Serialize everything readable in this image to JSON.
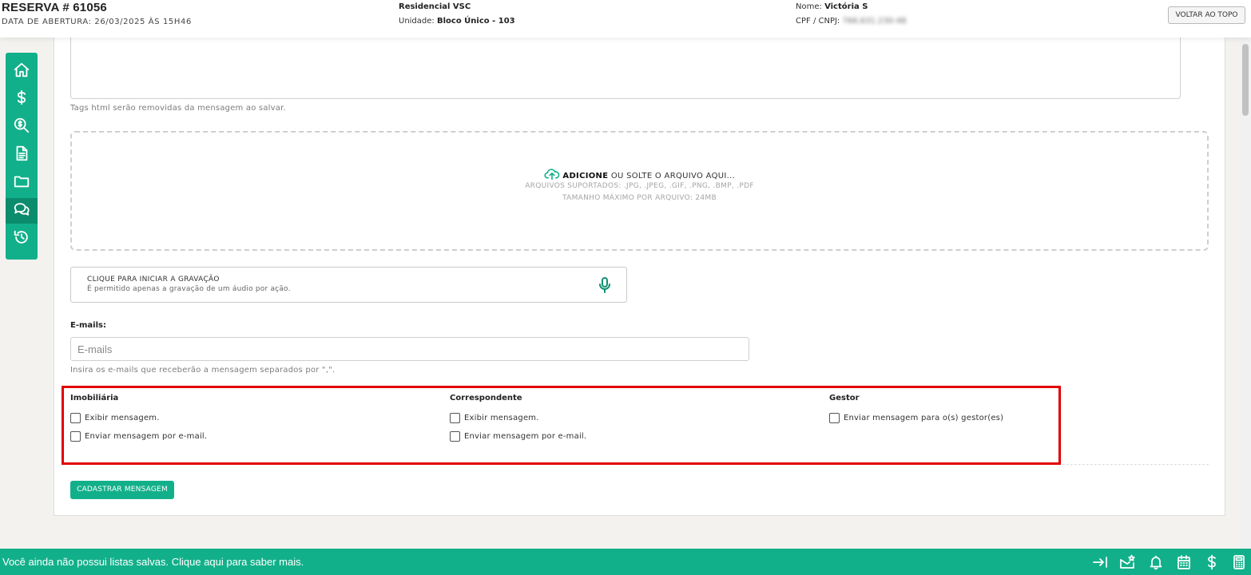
{
  "header": {
    "title": "RESERVA # 61056",
    "subtitle": "DATA DE ABERTURA: 26/03/2025 ÀS 15H46",
    "project_value": "Residencial VSC",
    "unit_label": "Unidade:",
    "unit_value": "Bloco Único - 103",
    "name_label": "Nome:",
    "name_value": "Victória S",
    "cpf_label": "CPF / CNPJ:",
    "cpf_value": "766.631.230-48",
    "back_to_top": "VOLTAR AO TOPO"
  },
  "sidebar": {
    "items": [
      {
        "icon": "home-icon"
      },
      {
        "icon": "dollar-icon"
      },
      {
        "icon": "search-dollar-icon"
      },
      {
        "icon": "document-icon"
      },
      {
        "icon": "folder-icon"
      },
      {
        "icon": "chat-icon",
        "active": true
      },
      {
        "icon": "history-icon"
      }
    ]
  },
  "message": {
    "hint": "Tags html serão removidas da mensagem ao salvar."
  },
  "upload": {
    "add_label": "ADICIONE",
    "drop_text": " OU SOLTE O ARQUIVO AQUI...",
    "formats": "ARQUIVOS SUPORTADOS: .JPG, .JPEG, .GIF, .PNG, .BMP, .PDF",
    "max_size": "TAMANHO MÁXIMO POR ARQUIVO: 24MB"
  },
  "recording": {
    "title": "CLIQUE PARA INICIAR A GRAVAÇÃO",
    "subtitle": "É permitido apenas a gravação de um áudio por ação."
  },
  "emails": {
    "label": "E-mails:",
    "placeholder": "E-mails",
    "hint": "Insira os e-mails que receberão a mensagem separados por \",\"."
  },
  "groups": {
    "imobiliaria": {
      "title": "Imobiliária",
      "options": [
        "Exibir mensagem.",
        "Enviar mensagem por e-mail."
      ]
    },
    "correspondente": {
      "title": "Correspondente",
      "options": [
        "Exibir mensagem.",
        "Enviar mensagem por e-mail."
      ]
    },
    "gestor": {
      "title": "Gestor",
      "options": [
        "Enviar mensagem para o(s) gestor(es)"
      ]
    }
  },
  "submit_label": "CADASTRAR MENSAGEM",
  "footer": {
    "text": "Você ainda não possui listas salvas. Clique aqui para saber mais.",
    "icons": [
      "arrow-to-right-icon",
      "mail-star-icon",
      "bell-icon",
      "calendar-icon",
      "dollar-icon",
      "calculator-icon"
    ]
  },
  "colors": {
    "accent": "#12b08a",
    "accent_dark": "#0b8c6c",
    "highlight_border": "#e00000"
  }
}
